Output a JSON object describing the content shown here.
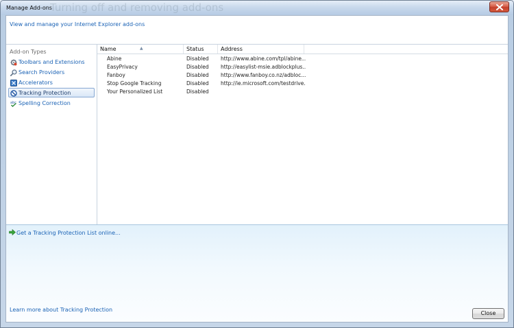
{
  "window": {
    "title": "Manage Add-ons",
    "background_text": "Turning off and removing add-ons"
  },
  "header": {
    "link_text": "View and manage your Internet Explorer add-ons"
  },
  "sidebar": {
    "heading": "Add-on Types",
    "items": [
      {
        "label": "Toolbars and Extensions",
        "icon": "gear-icon"
      },
      {
        "label": "Search Providers",
        "icon": "search-icon"
      },
      {
        "label": "Accelerators",
        "icon": "accelerator-icon"
      },
      {
        "label": "Tracking Protection",
        "icon": "block-icon",
        "selected": true
      },
      {
        "label": "Spelling Correction",
        "icon": "spelling-check-icon"
      }
    ]
  },
  "table": {
    "columns": [
      "Name",
      "Status",
      "Address"
    ],
    "rows": [
      {
        "name": "Abine",
        "status": "Disabled",
        "address": "http://www.abine.com/tpl/abine..."
      },
      {
        "name": "EasyPrivacy",
        "status": "Disabled",
        "address": "http://easylist-msie.adblockplus..."
      },
      {
        "name": "Fanboy",
        "status": "Disabled",
        "address": "http://www.fanboy.co.nz/adbloc..."
      },
      {
        "name": "Stop Google Tracking",
        "status": "Disabled",
        "address": "http://ie.microsoft.com/testdrive..."
      },
      {
        "name": "Your Personalized List",
        "status": "Disabled",
        "address": ""
      }
    ]
  },
  "details": {
    "get_list_label": "Get a Tracking Protection List online...",
    "learn_more_label": "Learn more about Tracking Protection",
    "close_label": "Close"
  },
  "colors": {
    "link": "#1a62b5",
    "selection_border": "#86a7d2",
    "details_background": "#e2f1fb"
  }
}
